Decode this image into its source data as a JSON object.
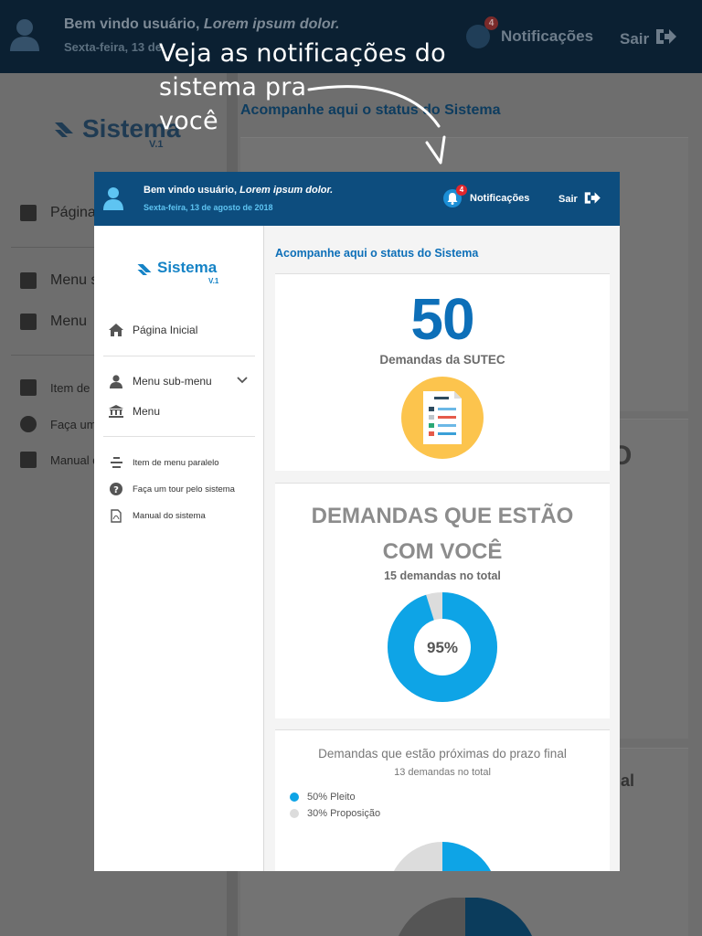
{
  "header": {
    "welcome_prefix": "Bem vindo usuário,",
    "welcome_name": "Lorem ipsum dolor.",
    "date": "Sexta-feira, 13 de agosto de 2018",
    "notifications_label": "Notificações",
    "notifications_count": "4",
    "logout_label": "Sair"
  },
  "background": {
    "date_partial": "Sexta-feira, 13 de",
    "sidebar_labels": [
      "Página",
      "Menu s",
      "Menu",
      "Item de",
      "Faça um",
      "Manual d"
    ],
    "partial_card_letter": "O",
    "partial_card_text": "nal"
  },
  "tooltip": {
    "line1": "Veja as notificações do",
    "line2": "sistema pra",
    "line3": "você"
  },
  "logo": {
    "name": "Sistema",
    "version": "V.1"
  },
  "sidebar": {
    "home": "Página Inicial",
    "submenu": "Menu sub-menu",
    "menu": "Menu",
    "parallel": "Item de menu paralelo",
    "tour": "Faça um tour pelo sistema",
    "manual": "Manual do sistema"
  },
  "main": {
    "status_title": "Acompanhe aqui o status do Sistema",
    "card1": {
      "value": "50",
      "label": "Demandas da SUTEC"
    },
    "card2": {
      "title_line1": "DEMANDAS QUE ESTÃO",
      "title_line2": "COM VOCÊ",
      "subtitle": "15 demandas no total",
      "percent_label": "95%",
      "percent_value": 95
    },
    "card3": {
      "title": "Demandas que estão próximas do prazo final",
      "subtitle": "13 demandas no total",
      "legend": [
        {
          "label": "50% Pleito",
          "color": "#0ea4e6"
        },
        {
          "label": "30% Proposição",
          "color": "#dcdcdc"
        }
      ]
    }
  },
  "colors": {
    "header_bg": "#0d4d7e",
    "accent": "#0d6fb8",
    "donut_blue": "#0ea4e6",
    "donut_grey": "#dcdcdc",
    "badge_red": "#e0262c",
    "doc_yellow": "#fcc44d"
  }
}
